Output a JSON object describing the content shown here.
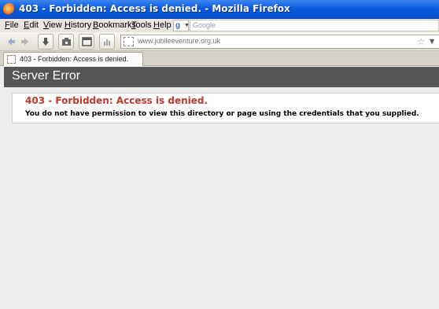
{
  "window": {
    "title": "403 - Forbidden: Access is denied. - Mozilla Firefox"
  },
  "menubar": {
    "items": [
      {
        "first": "F",
        "rest": "ile"
      },
      {
        "first": "E",
        "rest": "dit"
      },
      {
        "first": "V",
        "rest": "iew"
      },
      {
        "first": "H",
        "rest": "istory"
      },
      {
        "first": "B",
        "rest": "ookmarks"
      },
      {
        "first": "T",
        "rest": "ools"
      },
      {
        "first": "H",
        "rest": "elp"
      }
    ],
    "search_placeholder": "Google",
    "search_engine_glyph": "g"
  },
  "toolbar": {
    "url": "www.jubileeventure.org.uk"
  },
  "tabs": [
    {
      "label": "403 - Forbidden: Access is denied."
    }
  ],
  "page": {
    "header": "Server Error",
    "error_title": "403 - Forbidden: Access is denied.",
    "error_message": "You do not have permission to view this directory or page using the credentials that you supplied."
  },
  "colors": {
    "titlebar": "#0a5be0",
    "header_bar": "#555555",
    "error_title": "#c0392b"
  },
  "icons": [
    "firefox-logo-icon",
    "back-arrow-icon",
    "forward-arrow-icon",
    "download-icon",
    "home-icon",
    "window-icon",
    "page-icon",
    "stats-icon",
    "bookmark-star-icon",
    "dropdown-arrow-icon"
  ]
}
